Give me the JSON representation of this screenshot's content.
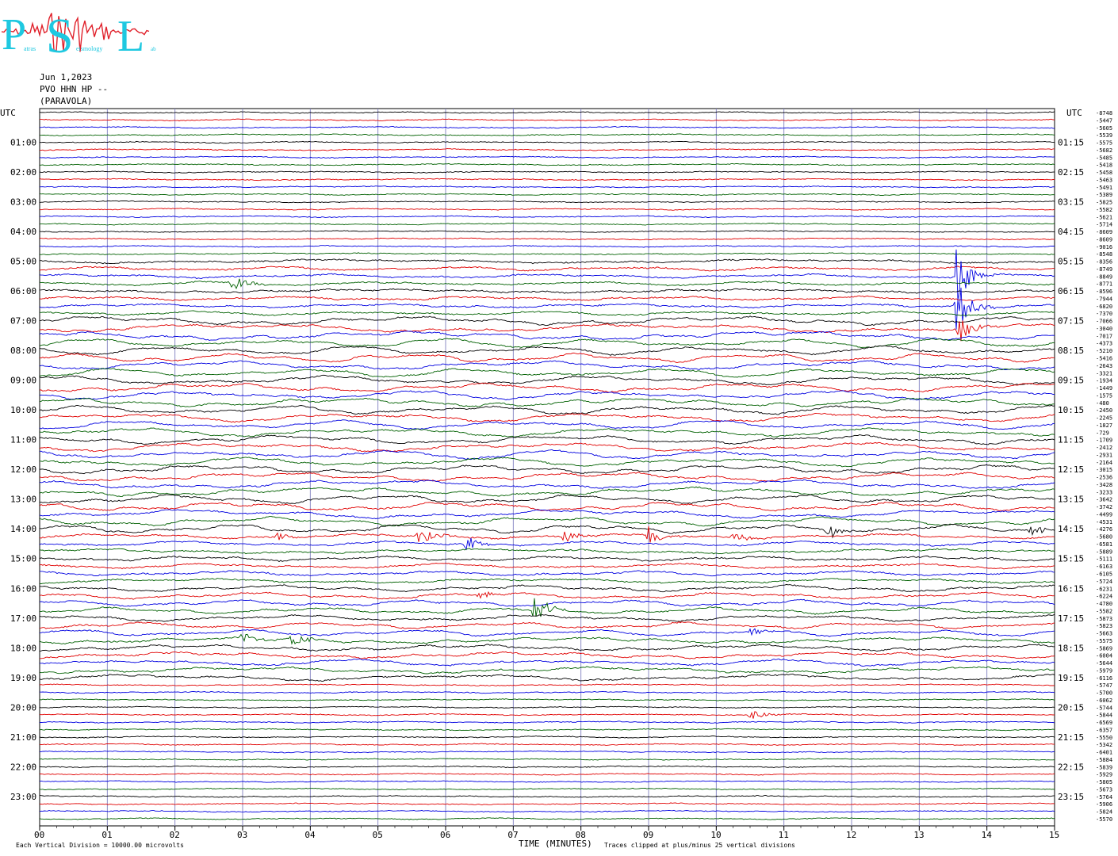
{
  "header": {
    "date": "Jun 1,2023",
    "station": "PVO HHN HP --",
    "location": "(PARAVOLA)"
  },
  "logo": {
    "letters": [
      "P",
      "S",
      "L"
    ],
    "words": [
      "atras",
      "eismology",
      "ab"
    ],
    "colors": {
      "letters": "#1ec8e0",
      "trace": "#e0202a"
    }
  },
  "colors": {
    "series": [
      "#000000",
      "#e00000",
      "#0000e0",
      "#006000"
    ],
    "grid": "#8080c0",
    "frame": "#000000"
  },
  "chart_data": {
    "type": "line",
    "title": "",
    "xlabel": "TIME (MINUTES)",
    "ylabel": "",
    "xlim": [
      0,
      15
    ],
    "x_ticks": [
      "00",
      "01",
      "02",
      "03",
      "04",
      "05",
      "06",
      "07",
      "08",
      "09",
      "10",
      "11",
      "12",
      "13",
      "14",
      "15"
    ],
    "left_corner_label": "UTC",
    "right_corner_label": "UTC",
    "left_hour_labels": [
      "01:00",
      "02:00",
      "03:00",
      "04:00",
      "05:00",
      "06:00",
      "07:00",
      "08:00",
      "09:00",
      "10:00",
      "11:00",
      "12:00",
      "13:00",
      "14:00",
      "15:00",
      "16:00",
      "17:00",
      "18:00",
      "19:00",
      "20:00",
      "21:00",
      "22:00",
      "23:00"
    ],
    "right_hour_labels": [
      "01:15",
      "02:15",
      "03:15",
      "04:15",
      "05:15",
      "06:15",
      "07:15",
      "08:15",
      "09:15",
      "10:15",
      "11:15",
      "12:15",
      "13:15",
      "14:15",
      "15:15",
      "16:15",
      "17:15",
      "18:15",
      "19:15",
      "20:15",
      "21:15",
      "22:15",
      "23:15"
    ],
    "trace_offsets": [
      -8748,
      -5447,
      -5605,
      -5539,
      -5575,
      -5682,
      -5485,
      -5418,
      -5458,
      -5463,
      -5491,
      -5389,
      -5825,
      -5582,
      -5621,
      -5714,
      -8609,
      -8609,
      -9016,
      -8548,
      -8356,
      -8749,
      -8849,
      -8771,
      -8596,
      -7944,
      -6820,
      -7370,
      -7066,
      -3040,
      -7017,
      -4373,
      -5210,
      -5416,
      -2643,
      -3321,
      -1934,
      -1449,
      -1575,
      -480,
      -2450,
      -2245,
      -1827,
      -729,
      -1709,
      -2412,
      -2931,
      -2164,
      -3015,
      -2536,
      -3428,
      -3233,
      -3642,
      -3742,
      -4499,
      -4531,
      -4276,
      -5680,
      -6581,
      -5889,
      -5111,
      -6163,
      -6105,
      -5724,
      -6231,
      -6224,
      -4780,
      -5582,
      -5873,
      -5823,
      -5663,
      -5575,
      -5869,
      -6004,
      -5644,
      -5979,
      -6116,
      -5747,
      -5700,
      -6062,
      -5744,
      -5844,
      -6569,
      -6357,
      -5550,
      -5342,
      -6401,
      -5884,
      -5839,
      -5929,
      -5805,
      -5673,
      -5764,
      -5906,
      -5824,
      -5570
    ],
    "traces_per_hour": 4,
    "trace_count": 96,
    "minutes_per_trace": 15,
    "events": [
      {
        "trace": 23,
        "minute": 2.85,
        "amp": 0.9
      },
      {
        "trace": 22,
        "minute": 13.55,
        "amp": 2.6
      },
      {
        "trace": 26,
        "minute": 13.55,
        "amp": 2.6
      },
      {
        "trace": 29,
        "minute": 13.55,
        "amp": 1.8
      },
      {
        "trace": 57,
        "minute": 5.6,
        "amp": 1.0
      },
      {
        "trace": 57,
        "minute": 7.75,
        "amp": 0.7
      },
      {
        "trace": 57,
        "minute": 9.0,
        "amp": 0.9
      },
      {
        "trace": 57,
        "minute": 10.25,
        "amp": 0.5
      },
      {
        "trace": 57,
        "minute": 3.5,
        "amp": 0.4
      },
      {
        "trace": 56,
        "minute": 11.65,
        "amp": 0.7
      },
      {
        "trace": 56,
        "minute": 14.65,
        "amp": 0.6
      },
      {
        "trace": 58,
        "minute": 6.3,
        "amp": 0.8
      },
      {
        "trace": 67,
        "minute": 7.3,
        "amp": 1.6
      },
      {
        "trace": 71,
        "minute": 3.7,
        "amp": 0.9
      },
      {
        "trace": 71,
        "minute": 3.0,
        "amp": 0.6
      },
      {
        "trace": 65,
        "minute": 6.5,
        "amp": 0.4
      },
      {
        "trace": 70,
        "minute": 10.5,
        "amp": 0.5
      },
      {
        "trace": 81,
        "minute": 10.5,
        "amp": 0.6
      }
    ],
    "footer_left": "Each Vertical Division = 10000.00 microvolts",
    "footer_right": "Traces clipped at plus/minus 25 vertical divisions"
  }
}
